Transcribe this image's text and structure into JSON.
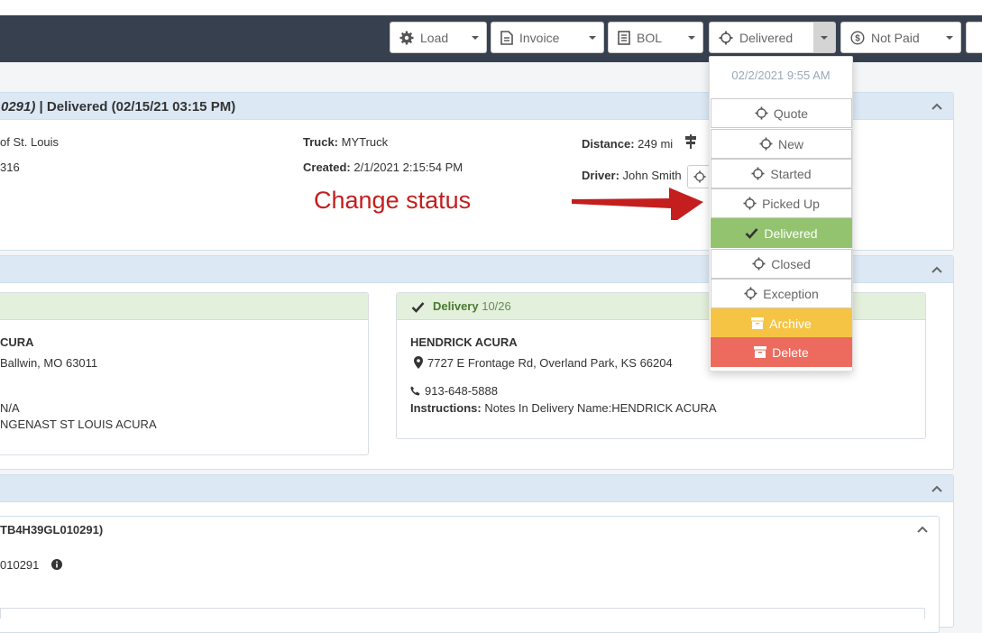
{
  "toolbar": {
    "load_label": "Load",
    "invoice_label": "Invoice",
    "bol_label": "BOL",
    "status_label": "Delivered",
    "payment_label": "Not Paid"
  },
  "header": {
    "title_italic": "0291)",
    "title_rest": " | Delivered (02/15/21 03:15 PM)"
  },
  "summary": {
    "left_line1": "of St. Louis",
    "left_line2": "316",
    "truck_label": "Truck:",
    "truck_value": "MYTruck",
    "created_label": "Created:",
    "created_value": "2/1/2021 2:15:54 PM",
    "distance_label": "Distance:",
    "distance_value": "249 mi",
    "driver_label": "Driver:",
    "driver_value": "John Smith"
  },
  "annotation": {
    "text": "Change status"
  },
  "pickup": {
    "name": "CURA",
    "address": "Ballwin, MO 63011",
    "phone": "N/A",
    "instructions": "NGENAST ST LOUIS ACURA"
  },
  "delivery": {
    "title": "Delivery",
    "date": "10/26",
    "name": "HENDRICK ACURA",
    "address": "7727 E Frontage Rd, Overland Park, KS 66204",
    "phone": "913-648-5888",
    "instructions_label": "Instructions:",
    "instructions_value": "Notes In Delivery Name:HENDRICK ACURA"
  },
  "vehicle": {
    "title": "TB4H39GL010291)",
    "vin": "010291"
  },
  "status_dropdown": {
    "date": "02/2/2021 9:55 AM",
    "items": [
      {
        "label": "Quote"
      },
      {
        "label": "New"
      },
      {
        "label": "Started"
      },
      {
        "label": "Picked Up"
      },
      {
        "label": "Delivered"
      },
      {
        "label": "Closed"
      },
      {
        "label": "Exception"
      },
      {
        "label": "Archive"
      },
      {
        "label": "Delete"
      }
    ]
  },
  "colors": {
    "navbar": "#36404f",
    "delivered_green": "#93c36f",
    "archive_yellow": "#f6c445",
    "delete_red": "#ec6b5e",
    "annotation_red": "#c41e1e",
    "panel_header": "#dce9f5"
  }
}
